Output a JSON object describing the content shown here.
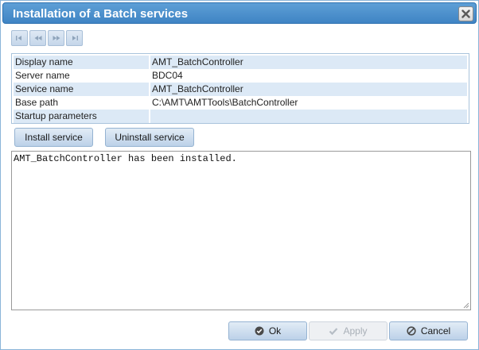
{
  "window": {
    "title": "Installation of a Batch services"
  },
  "nav": {
    "first_icon": "first-page-icon",
    "prev_icon": "previous-page-icon",
    "next_icon": "next-page-icon",
    "last_icon": "last-page-icon"
  },
  "properties": [
    {
      "label": "Display name",
      "value": "AMT_BatchController"
    },
    {
      "label": "Server name",
      "value": "BDC04"
    },
    {
      "label": "Service name",
      "value": "AMT_BatchController"
    },
    {
      "label": "Base path",
      "value": "C:\\AMT\\AMTTools\\BatchController"
    },
    {
      "label": "Startup parameters",
      "value": ""
    }
  ],
  "actions": {
    "install_label": "Install service",
    "uninstall_label": "Uninstall service"
  },
  "log": {
    "text": "AMT_BatchController has been installed."
  },
  "footer": {
    "ok_label": "Ok",
    "apply_label": "Apply",
    "cancel_label": "Cancel"
  },
  "colors": {
    "titlebar": "#4a8fcc",
    "row_alt": "#dce9f6",
    "button": "#c8d9ec"
  }
}
